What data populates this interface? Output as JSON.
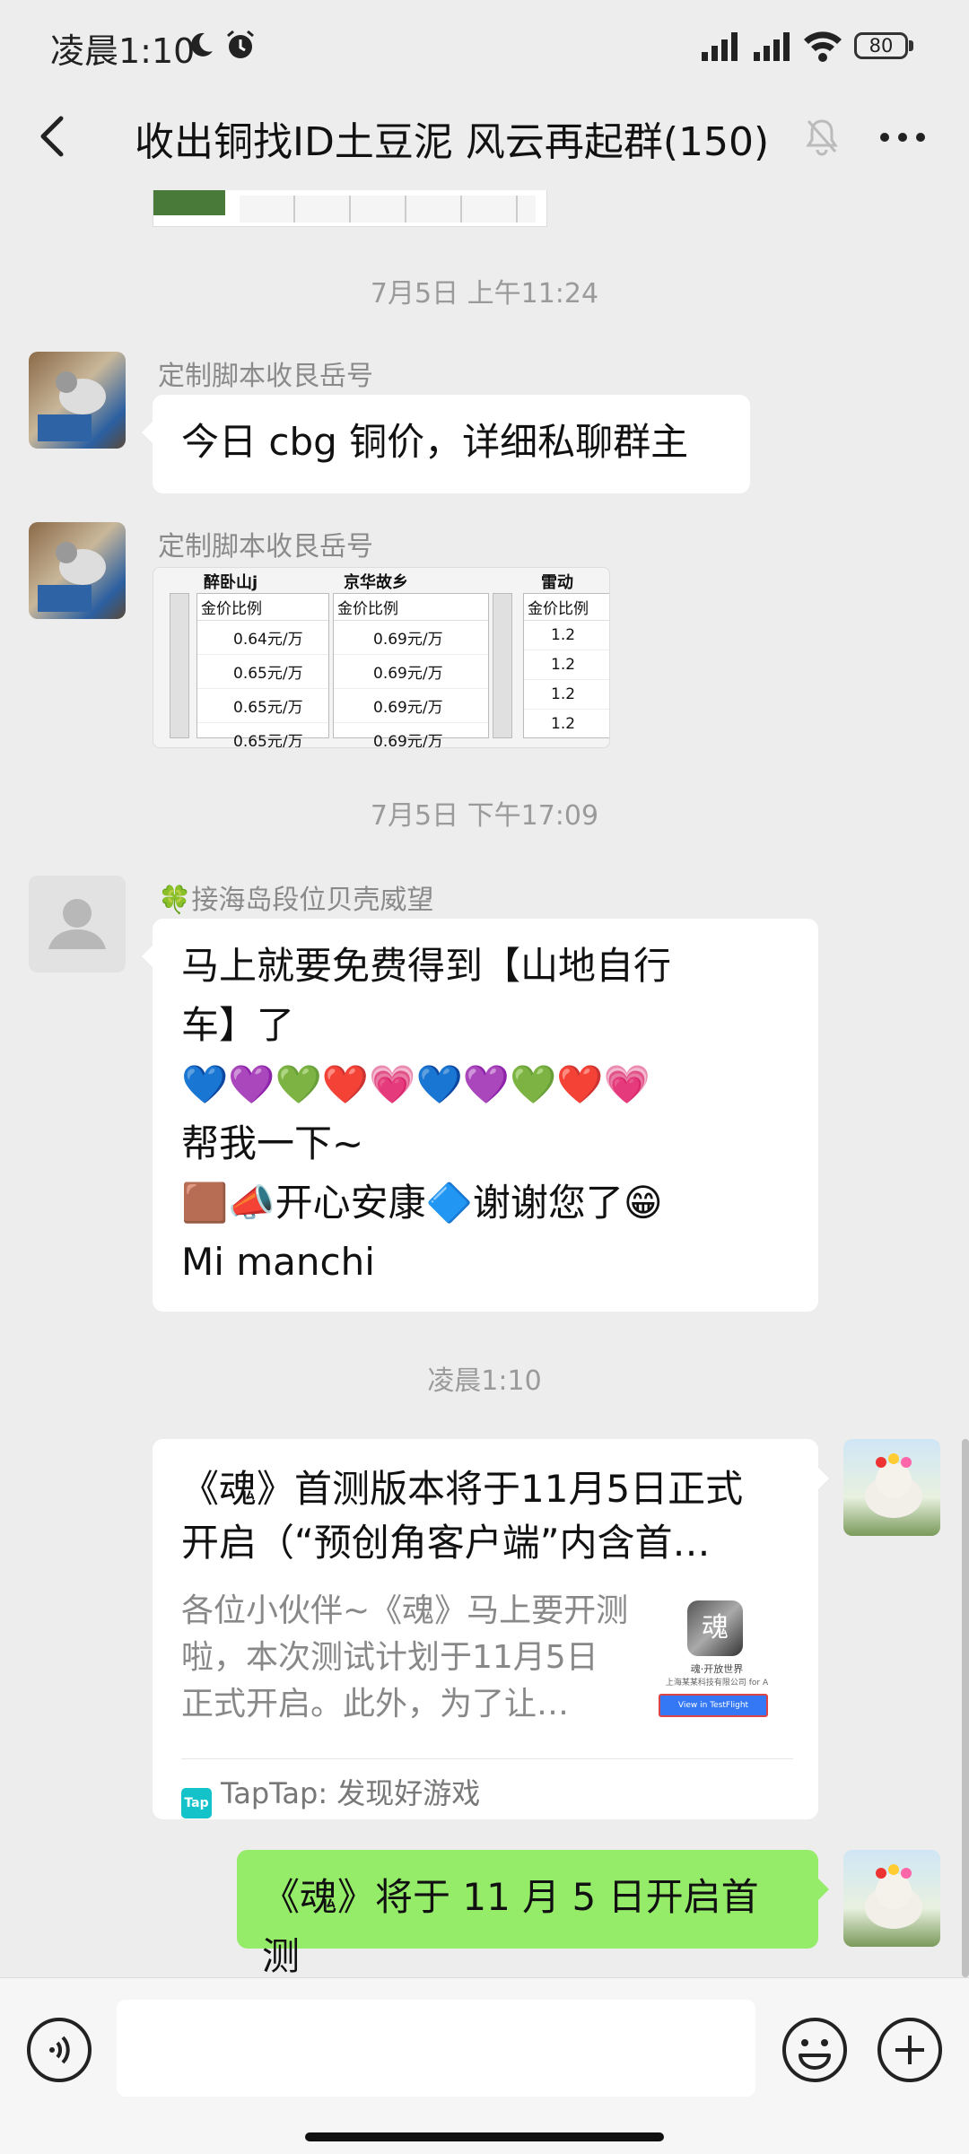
{
  "status_bar": {
    "time": "凌晨1:10",
    "battery": "80"
  },
  "header": {
    "title": "收出铜找ID土豆泥  风云再起群(150)"
  },
  "messages": {
    "ts1": "7月5日 上午11:24",
    "m1_sender": "定制脚本收艮岳号",
    "m1_text": "今日 cbg 铜价，详细私聊群主",
    "m2_sender": "定制脚本收艮岳号",
    "ts2": "7月5日 下午17:09",
    "m3_sender": "🍀接海岛段位贝壳威望",
    "m3_line1": "马上就要免费得到【山地自行",
    "m3_line2": "车】了",
    "m3_line3": "💙💜💚❤️💗💙💜💚❤️💗",
    "m3_line4": "帮我一下~",
    "m3_line5": "🟫📣开心安康🔷谢谢您了😁",
    "m3_line6": "Mi manchi",
    "ts3": "凌晨1:10",
    "card_title": "《魂》首测版本将于11月5日正式开启（“预创角客户端”内含首…",
    "card_desc": "各位小伙伴~《魂》马上要开测啦，本次测试计划于11月5日正式开启。此外，为了让…",
    "card_source": "TapTap: 发现好游戏",
    "card_logo": "Tap",
    "m5_text": "《魂》将于 11 月 5 日开启首测"
  },
  "price_table": {
    "columns": [
      {
        "title": "醉卧山j",
        "header": "金价比例",
        "rows": [
          "0.64元/万",
          "0.65元/万",
          "0.65元/万",
          "0.65元/万"
        ]
      },
      {
        "title": "京华故乡",
        "header": "金价比例",
        "rows": [
          "0.69元/万",
          "0.69元/万",
          "0.69元/万",
          "0.69元/万"
        ]
      },
      {
        "title": "雷动",
        "header": "金价比例",
        "rows": [
          "1.2",
          "1.2",
          "1.2",
          "1.2"
        ]
      }
    ]
  },
  "thumb": {
    "game_title": "魂·开放世界",
    "company": "上海某某科技有限公司 for A",
    "button": "View in TestFlight"
  },
  "colors": {
    "bg": "#ededed",
    "green_bubble": "#95ec69",
    "taptap": "#14c2c9"
  }
}
